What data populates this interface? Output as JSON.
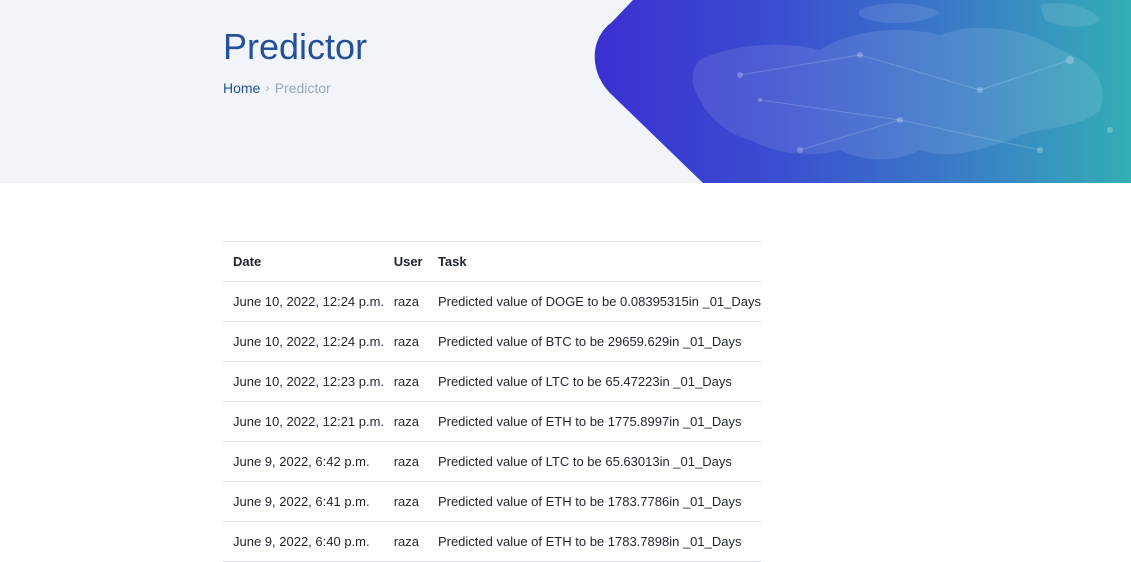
{
  "header": {
    "title": "Predictor",
    "breadcrumb": {
      "home": "Home",
      "separator": "›",
      "current": "Predictor"
    }
  },
  "colors": {
    "hero_background": "#f1f4f8",
    "title": "#24509a",
    "blob_start": "#3b2fd1",
    "blob_end": "#33aeb6"
  },
  "table": {
    "headers": {
      "date": "Date",
      "user": "User",
      "task": "Task"
    },
    "rows": [
      {
        "date": "June 10, 2022, 12:24 p.m.",
        "user": "raza",
        "task": "Predicted value of DOGE to be 0.08395315in _01_Days"
      },
      {
        "date": "June 10, 2022, 12:24 p.m.",
        "user": "raza",
        "task": "Predicted value of BTC to be 29659.629in _01_Days"
      },
      {
        "date": "June 10, 2022, 12:23 p.m.",
        "user": "raza",
        "task": "Predicted value of LTC to be 65.47223in _01_Days"
      },
      {
        "date": "June 10, 2022, 12:21 p.m.",
        "user": "raza",
        "task": "Predicted value of ETH to be 1775.8997in _01_Days"
      },
      {
        "date": "June 9, 2022, 6:42 p.m.",
        "user": "raza",
        "task": "Predicted value of LTC to be 65.63013in _01_Days"
      },
      {
        "date": "June 9, 2022, 6:41 p.m.",
        "user": "raza",
        "task": "Predicted value of ETH to be 1783.7786in _01_Days"
      },
      {
        "date": "June 9, 2022, 6:40 p.m.",
        "user": "raza",
        "task": "Predicted value of ETH to be 1783.7898in _01_Days"
      }
    ]
  }
}
